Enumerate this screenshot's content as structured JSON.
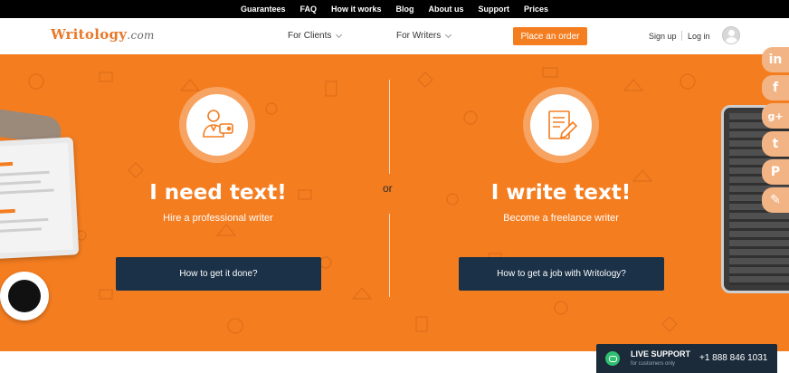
{
  "top_nav": [
    "Guarantees",
    "FAQ",
    "How it works",
    "Blog",
    "About us",
    "Support",
    "Prices"
  ],
  "header": {
    "logo_text": "Writology",
    "logo_suffix": ".com",
    "for_clients": "For Clients",
    "for_writers": "For Writers",
    "place_order": "Place an order",
    "sign_up": "Sign up",
    "log_in": "Log in"
  },
  "hero": {
    "or": "or",
    "left": {
      "title": "I need text!",
      "subtitle": "Hire a professional writer",
      "button": "How to get it done?",
      "icon": "businessman-wallet-icon"
    },
    "right": {
      "title": "I write text!",
      "subtitle": "Become a freelance writer",
      "button": "How to get a job with Writology?",
      "icon": "document-pen-icon"
    }
  },
  "social": [
    {
      "name": "linkedin-icon",
      "glyph": "in"
    },
    {
      "name": "facebook-icon",
      "glyph": "f"
    },
    {
      "name": "google-plus-icon",
      "glyph": "g+"
    },
    {
      "name": "tumblr-icon",
      "glyph": "t"
    },
    {
      "name": "pinterest-icon",
      "glyph": "P"
    },
    {
      "name": "edit-icon",
      "glyph": "✎"
    }
  ],
  "live_support": {
    "title": "LIVE SUPPORT",
    "subtitle": "for customers only",
    "phone": "+1 888 846 1031"
  },
  "colors": {
    "brand_orange": "#f47d20",
    "dark_navy": "#1b3147"
  }
}
